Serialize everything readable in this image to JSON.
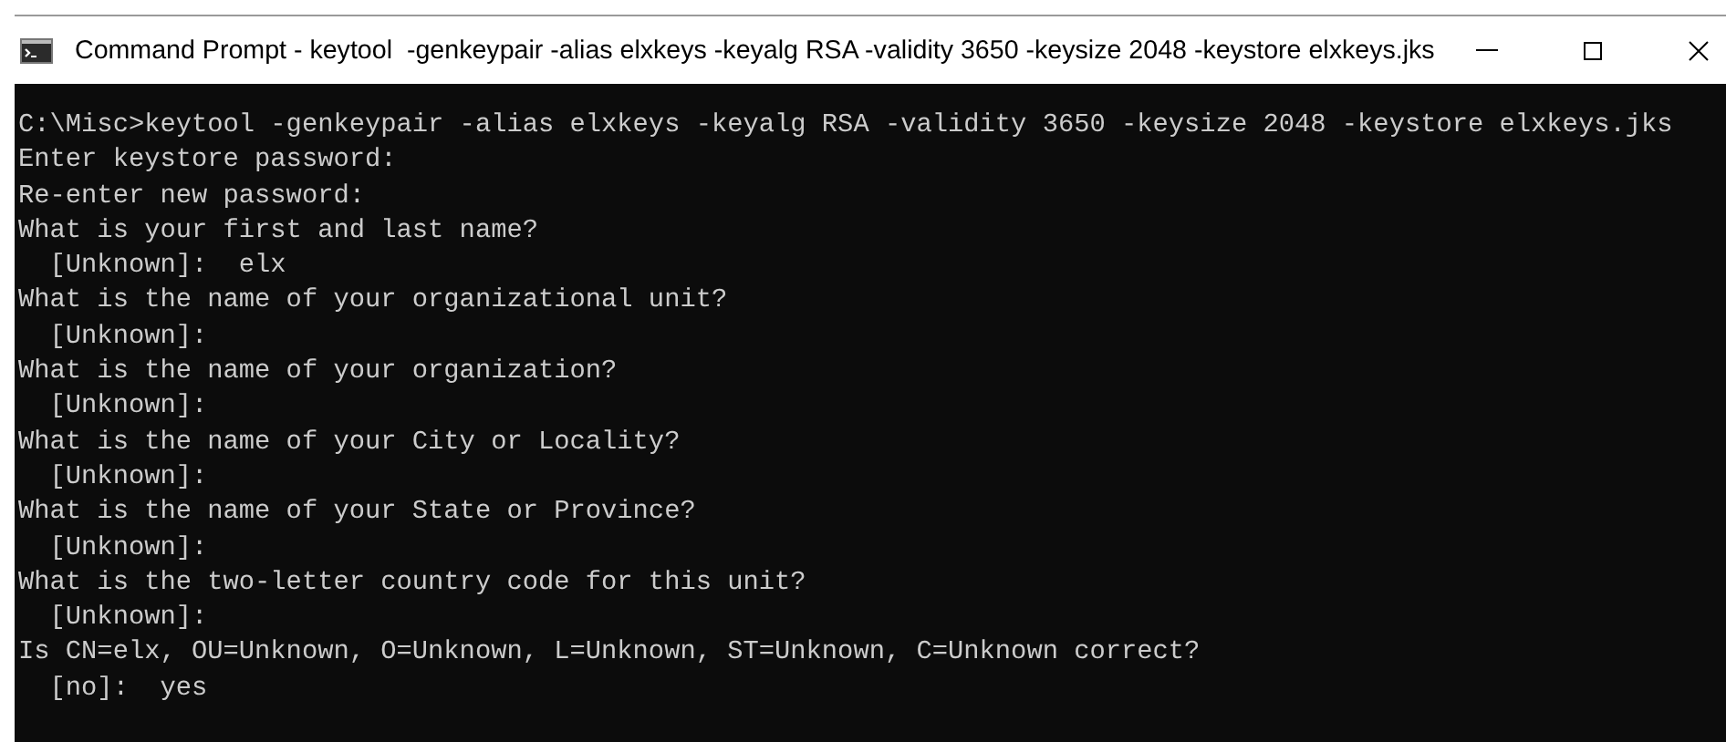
{
  "window": {
    "title": "Command Prompt - keytool  -genkeypair -alias elxkeys -keyalg RSA -validity 3650 -keysize 2048 -keystore elxkeys.jks"
  },
  "terminal": {
    "lines": [
      "C:\\Misc>keytool -genkeypair -alias elxkeys -keyalg RSA -validity 3650 -keysize 2048 -keystore elxkeys.jks",
      "Enter keystore password:",
      "Re-enter new password:",
      "What is your first and last name?",
      "  [Unknown]:  elx",
      "What is the name of your organizational unit?",
      "  [Unknown]:",
      "What is the name of your organization?",
      "  [Unknown]:",
      "What is the name of your City or Locality?",
      "  [Unknown]:",
      "What is the name of your State or Province?",
      "  [Unknown]:",
      "What is the two-letter country code for this unit?",
      "  [Unknown]:",
      "Is CN=elx, OU=Unknown, O=Unknown, L=Unknown, ST=Unknown, C=Unknown correct?",
      "  [no]:  yes"
    ]
  }
}
